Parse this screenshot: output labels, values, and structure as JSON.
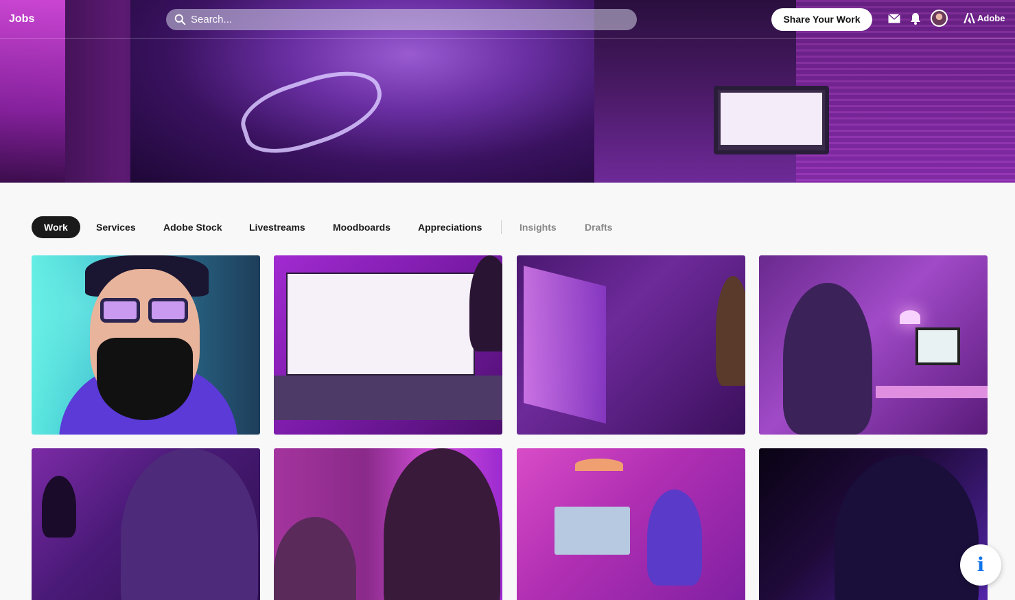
{
  "topbar": {
    "jobs_label": "Jobs",
    "search_placeholder": "Search...",
    "share_label": "Share Your Work",
    "brand_label": "Adobe",
    "icons": [
      "search-icon",
      "mail-icon",
      "bell-icon",
      "avatar",
      "adobe-logo-icon"
    ]
  },
  "tabs": [
    {
      "label": "Work",
      "active": true
    },
    {
      "label": "Services"
    },
    {
      "label": "Adobe Stock"
    },
    {
      "label": "Livestreams"
    },
    {
      "label": "Moodboards"
    },
    {
      "label": "Appreciations"
    },
    {
      "label": "Insights",
      "muted": true
    },
    {
      "label": "Drafts",
      "muted": true
    }
  ],
  "gallery": {
    "tile_count": 8
  },
  "info_button": {
    "glyph": "i",
    "accent": "#1273eb"
  },
  "colors": {
    "accent_purple": "#8a2bb8",
    "active_tab_bg": "#1a1a1a"
  }
}
